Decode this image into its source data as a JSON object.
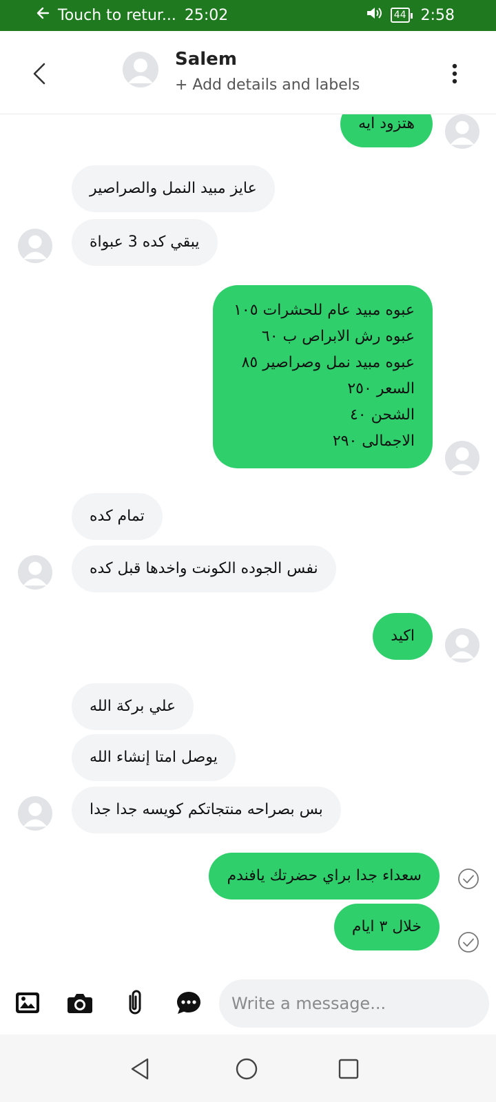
{
  "status_bar": {
    "return_text": "Touch to retur...",
    "call_timer": "25:02",
    "battery_level": "44",
    "clock": "2:58"
  },
  "header": {
    "contact_name": "Salem",
    "add_details": "+ Add details and labels"
  },
  "messages": [
    {
      "direction": "out",
      "text": "هتزود ايه"
    },
    {
      "direction": "in",
      "text": "عايز مبيد النمل والصراصير"
    },
    {
      "direction": "in",
      "text": "يبقي كده 3 عبواة"
    },
    {
      "direction": "out",
      "lines": [
        "عبوه مبيد عام للحشرات ١٠٥",
        "عبوه رش الابراص ب ٦٠",
        "عبوه مبيد نمل وصراصير ٨٥",
        "السعر ٢٥٠",
        "الشحن ٤٠",
        "الاجمالى ٢٩٠"
      ]
    },
    {
      "direction": "in",
      "text": "تمام كده"
    },
    {
      "direction": "in",
      "text": "نفس الجوده الكونت واخدها قبل كده"
    },
    {
      "direction": "out",
      "text": "اكيد"
    },
    {
      "direction": "in",
      "text": "علي بركة الله"
    },
    {
      "direction": "in",
      "text": "يوصل امتا إنشاء الله"
    },
    {
      "direction": "in",
      "text": "بس بصراحه منتجاتكم كويسه جدا جدا"
    },
    {
      "direction": "out",
      "text": "سعداء جدا براي حضرتك يافندم",
      "status": "sent"
    },
    {
      "direction": "out",
      "text": "خلال ٣ ايام",
      "status": "sent"
    }
  ],
  "input": {
    "placeholder": "Write a message..."
  },
  "icons": {
    "gallery": "image-icon",
    "camera": "camera-icon",
    "attach": "paperclip-icon",
    "quick_reply": "chat-bubble-icon"
  },
  "colors": {
    "status_bar": "#1f7a1f",
    "outgoing_bubble": "#2fd06c",
    "incoming_bubble": "#f3f4f6"
  }
}
